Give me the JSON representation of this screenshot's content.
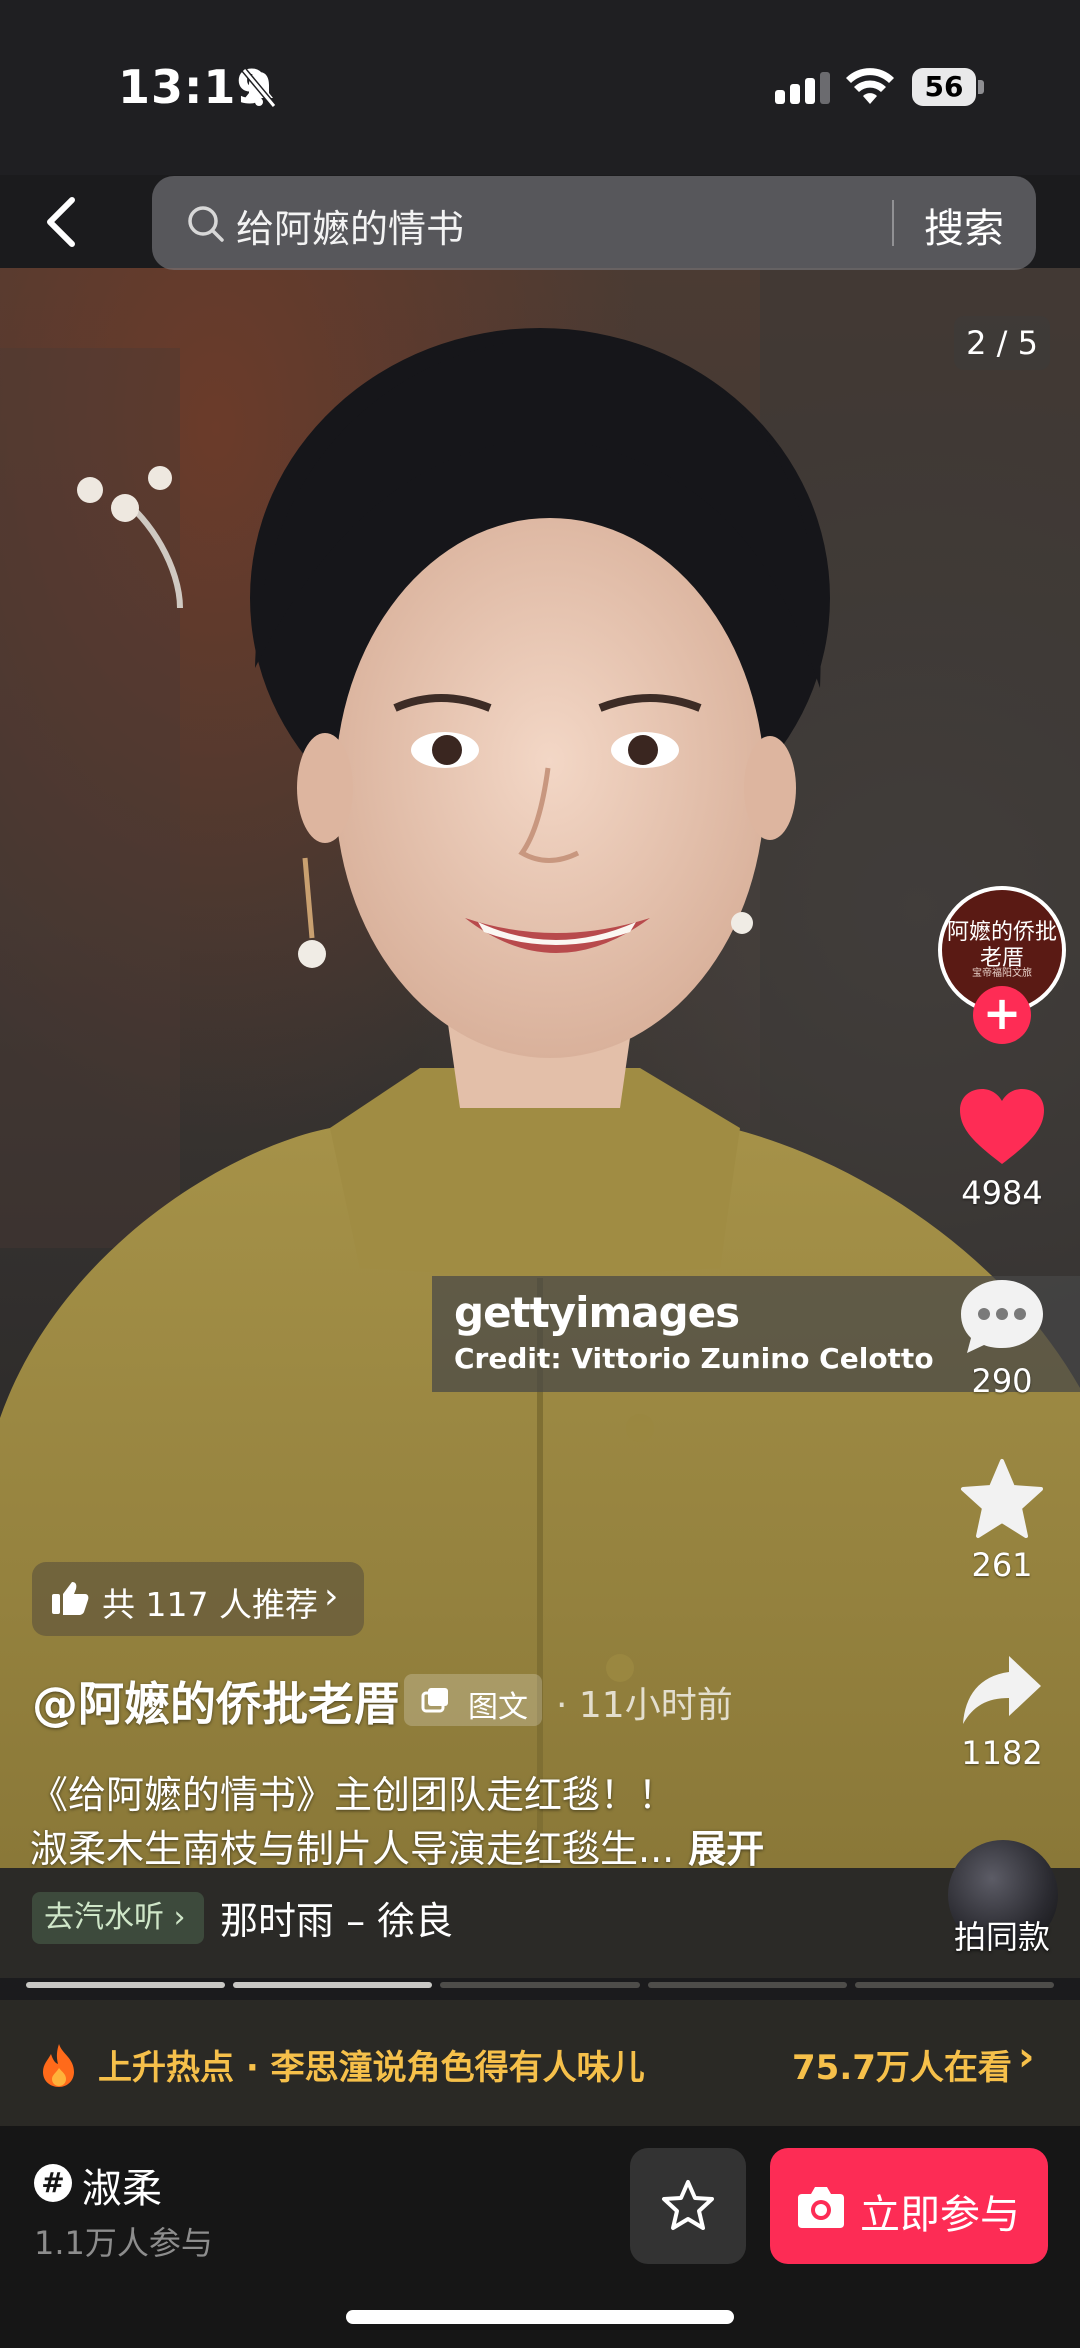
{
  "status_bar": {
    "time": "13:19",
    "battery": "56"
  },
  "search": {
    "query": "给阿嬷的情书",
    "button_label": "搜索"
  },
  "photo": {
    "page_counter": "2 / 5",
    "watermark_logo": "gettyimages",
    "watermark_credit": "Credit: Vittorio Zunino Celotto"
  },
  "actions": {
    "avatar_text": "阿嬷的侨批老厝",
    "avatar_sub": "宝帝福阳文旅",
    "follow_label": "+",
    "likes": "4984",
    "comments": "290",
    "favorites": "261",
    "shares": "1182",
    "same_style_label": "拍同款"
  },
  "post": {
    "recommend_text": "共 117 人推荐",
    "author": "@阿嬷的侨批老厝",
    "type_tag": "图文",
    "time": "· 11小时前",
    "caption_line1": "《给阿嬷的情书》主创团队走红毯！！",
    "caption_line2": "淑柔木生南枝与制片人导演走红毯生...",
    "expand_label": "展开"
  },
  "music": {
    "tag": "去汽水听 ›",
    "title": "那时雨 – 徐良"
  },
  "progress": {
    "total": 5,
    "done": 2
  },
  "hot": {
    "text": "上升热点 · 李思潼说角色得有人味儿",
    "count": "75.7万人在看"
  },
  "topic": {
    "name": "淑柔",
    "participants": "1.1万人参与",
    "join_label": "立即参与"
  },
  "colors": {
    "accent": "#fd2c55",
    "hot": "#f6c04a",
    "music_tag": "#3d4a3c"
  },
  "icons": [
    "back-chevron-icon",
    "search-icon",
    "heart-icon",
    "comment-icon",
    "star-icon",
    "share-icon",
    "thumbs-up-icon",
    "flame-icon",
    "camera-icon",
    "hashtag-icon"
  ]
}
